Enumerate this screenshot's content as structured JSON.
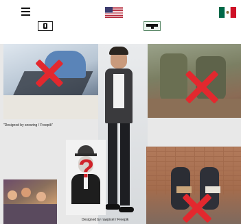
{
  "header": {
    "menu_icon": "hamburger-menu-icon",
    "flags": [
      {
        "name": "us-flag-icon",
        "label": "English"
      },
      {
        "name": "mexico-flag-icon",
        "label": "Español"
      }
    ],
    "buttons": [
      {
        "name": "text-size-button",
        "icon": "text-icon"
      },
      {
        "name": "presentation-button",
        "icon": "presentation-icon"
      }
    ]
  },
  "collage": {
    "credit_left": "\"Designed by snowing / Freepik\"",
    "credit_bottom": "Designed by rawpixel / Freepik"
  },
  "colors": {
    "cross": "#e3282e",
    "background": "#e8e8e8"
  }
}
